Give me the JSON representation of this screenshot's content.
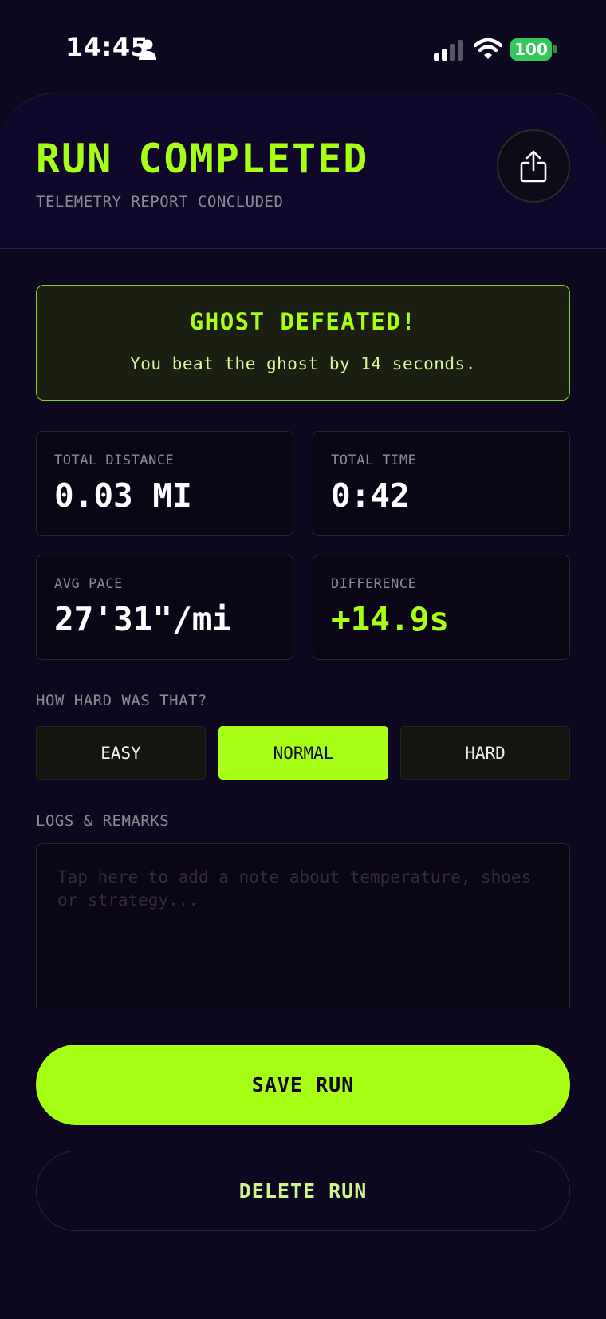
{
  "status_bar": {
    "time": "14:45",
    "battery": "100",
    "icons": [
      "person-icon",
      "cellular-signal-icon",
      "wifi-icon",
      "battery-icon"
    ]
  },
  "header": {
    "title": "RUN COMPLETED",
    "subtitle": "TELEMETRY REPORT CONCLUDED",
    "share_icon": "share-icon"
  },
  "banner": {
    "title": "GHOST DEFEATED!",
    "message": "You beat the ghost by 14 seconds."
  },
  "stats": [
    {
      "label": "TOTAL DISTANCE",
      "value": "0.03 MI"
    },
    {
      "label": "TOTAL TIME",
      "value": "0:42"
    },
    {
      "label": "AVG PACE",
      "value": "27'31\"/mi"
    },
    {
      "label": "DIFFERENCE",
      "value": "+14.9s"
    }
  ],
  "difficulty": {
    "label": "HOW HARD WAS THAT?",
    "options": [
      "EASY",
      "NORMAL",
      "HARD"
    ],
    "selected": "NORMAL"
  },
  "notes": {
    "label": "LOGS & REMARKS",
    "placeholder": "Tap here to add a note about temperature, shoes or strategy...",
    "value": ""
  },
  "actions": {
    "save_label": "SAVE RUN",
    "delete_label": "DELETE RUN"
  },
  "colors": {
    "background": "#0e0720",
    "accent": "#a6ff14",
    "muted_text": "#8e8a93",
    "battery": "#34c759"
  }
}
